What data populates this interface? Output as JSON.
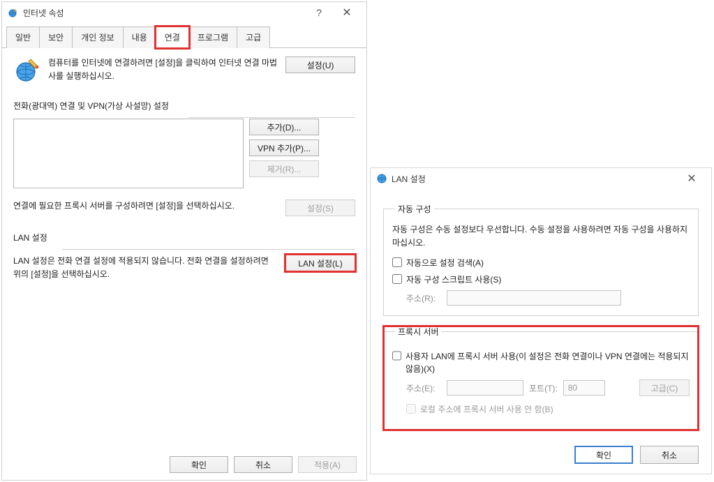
{
  "win1": {
    "title": "인터넷 속성",
    "help": "?",
    "close": "✕",
    "tabs": [
      "일반",
      "보안",
      "개인 정보",
      "내용",
      "연결",
      "프로그램",
      "고급"
    ],
    "active_tab_index": 4,
    "intro": "컴퓨터를 인터넷에 연결하려면 [설정]을 클릭하여 인터넷 연결 마법사를 실행하십시오.",
    "btn_setup": "설정(U)",
    "group_dial": "전화(광대역) 연결 및 VPN(가상 사설망) 설정",
    "btn_add": "추가(D)...",
    "btn_vpn_add": "VPN 추가(P)...",
    "btn_remove": "제거(R)...",
    "note": "연결에 필요한 프록시 서버를 구성하려면 [설정]을 선택하십시오.",
    "btn_settings": "설정(S)",
    "group_lan": "LAN 설정",
    "lan_note": "LAN 설정은 전화 연결 설정에 적용되지 않습니다. 전화 연결을 설정하려면 위의 [설정]을 선택하십시오.",
    "btn_lan": "LAN 설정(L)",
    "footer_ok": "확인",
    "footer_cancel": "취소",
    "footer_apply": "적용(A)"
  },
  "win2": {
    "title": "LAN 설정",
    "close": "✕",
    "group_auto": "자동 구성",
    "auto_desc": "자동 구성은 수동 설정보다 우선합니다. 수동 설정을 사용하려면 자동 구성을 사용하지 마십시오.",
    "chk_auto_detect": "자동으로 설정 검색(A)",
    "chk_auto_script": "자동 구성 스크립트 사용(S)",
    "lbl_addr": "주소(R):",
    "addr_value": "",
    "group_proxy": "프록시 서버",
    "chk_use_proxy": "사용자 LAN에 프록시 서버 사용(이 설정은 전화 연결이나 VPN 연결에는 적용되지 않음)(X)",
    "lbl_proxy_addr": "주소(E):",
    "proxy_addr_value": "",
    "lbl_port": "포트(T):",
    "port_value": "80",
    "btn_advanced": "고급(C)",
    "chk_bypass_local": "로컬 주소에 프록시 서버 사용 안 함(B)",
    "footer_ok": "확인",
    "footer_cancel": "취소"
  }
}
